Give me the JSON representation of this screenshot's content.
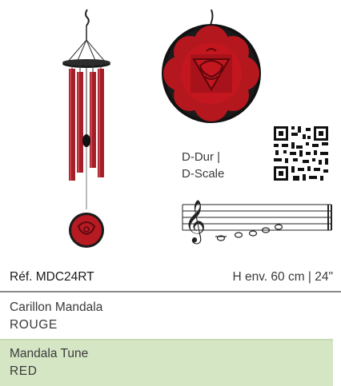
{
  "product": {
    "scale_line1": "D-Dur |",
    "scale_line2": "D-Scale",
    "reference": "Réf. MDC24RT",
    "size": "H env. 60 cm | 24\"",
    "name_fr": "Carillon Mandala",
    "color_fr": "ROUGE",
    "name_en": "Mandala Tune",
    "color_en": "RED"
  },
  "colors": {
    "tube_red": "#b0222c",
    "disc_red": "#c0171f",
    "accent_green": "#d5e6c5"
  },
  "icons": {
    "chime": "wind-chime-illustration",
    "mandala": "root-chakra-mandala",
    "qr": "qr-code",
    "staff": "treble-clef-staff"
  }
}
